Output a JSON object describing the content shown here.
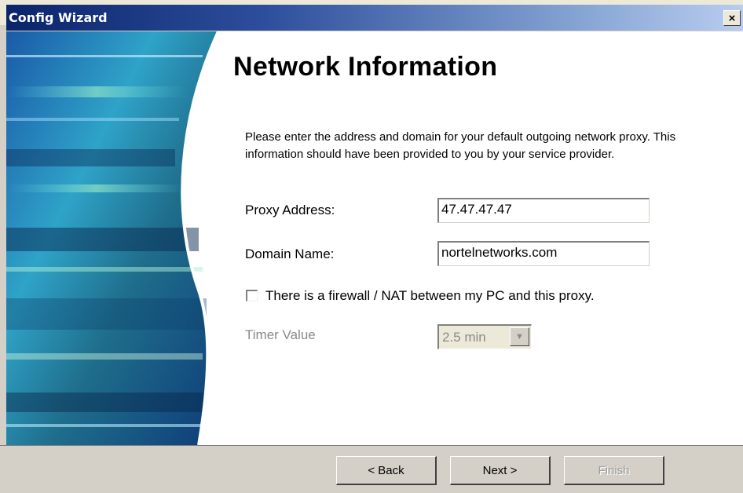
{
  "window": {
    "title": "Config Wizard",
    "close_glyph": "×"
  },
  "page": {
    "heading": "Network Information",
    "description": "Please enter the address and domain for your default outgoing network proxy. This information should have been provided to you by your service provider."
  },
  "form": {
    "proxy_label": "Proxy Address:",
    "proxy_value": "47.47.47.47",
    "domain_label": "Domain Name:",
    "domain_value": "nortelnetworks.com",
    "firewall_checkbox_label": "There is a firewall / NAT between my PC and this proxy.",
    "firewall_checked": false,
    "timer_label": "Timer Value",
    "timer_value": "2.5 min",
    "timer_enabled": false
  },
  "buttons": {
    "back": "< Back",
    "next": "Next >",
    "finish": "Finish"
  },
  "colors": {
    "title_bar": "#0a246a",
    "dialog_face": "#d4d0c8",
    "disabled_text": "#8a8a8a"
  }
}
